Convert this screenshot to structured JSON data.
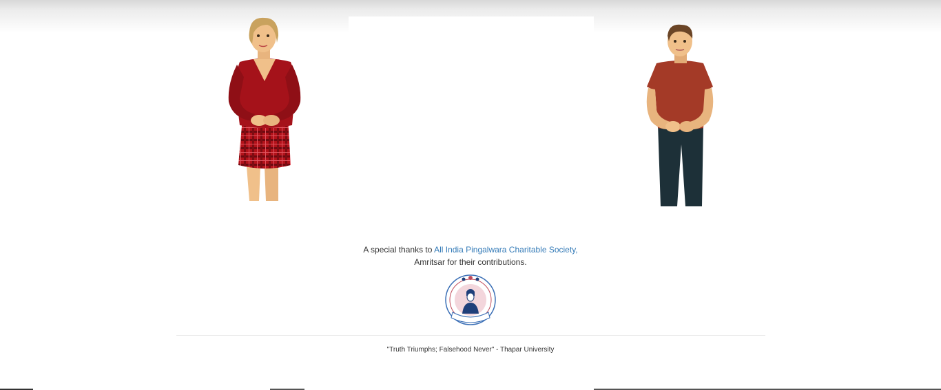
{
  "credits": {
    "prefix": "A special thanks to ",
    "org_link": "All India Pingalwara Charitable Society,",
    "line2": "Amritsar for their contributions."
  },
  "footer": {
    "quote": "\"Truth Triumphs; Falsehood Never\" - Thapar University"
  },
  "colors": {
    "link": "#337ab7",
    "text": "#333333",
    "divider": "#e6e6e6"
  },
  "icons": {
    "female_avatar": "female-sign-language-avatar",
    "male_avatar": "male-sign-language-avatar",
    "seal": "pingalwara-society-seal"
  }
}
